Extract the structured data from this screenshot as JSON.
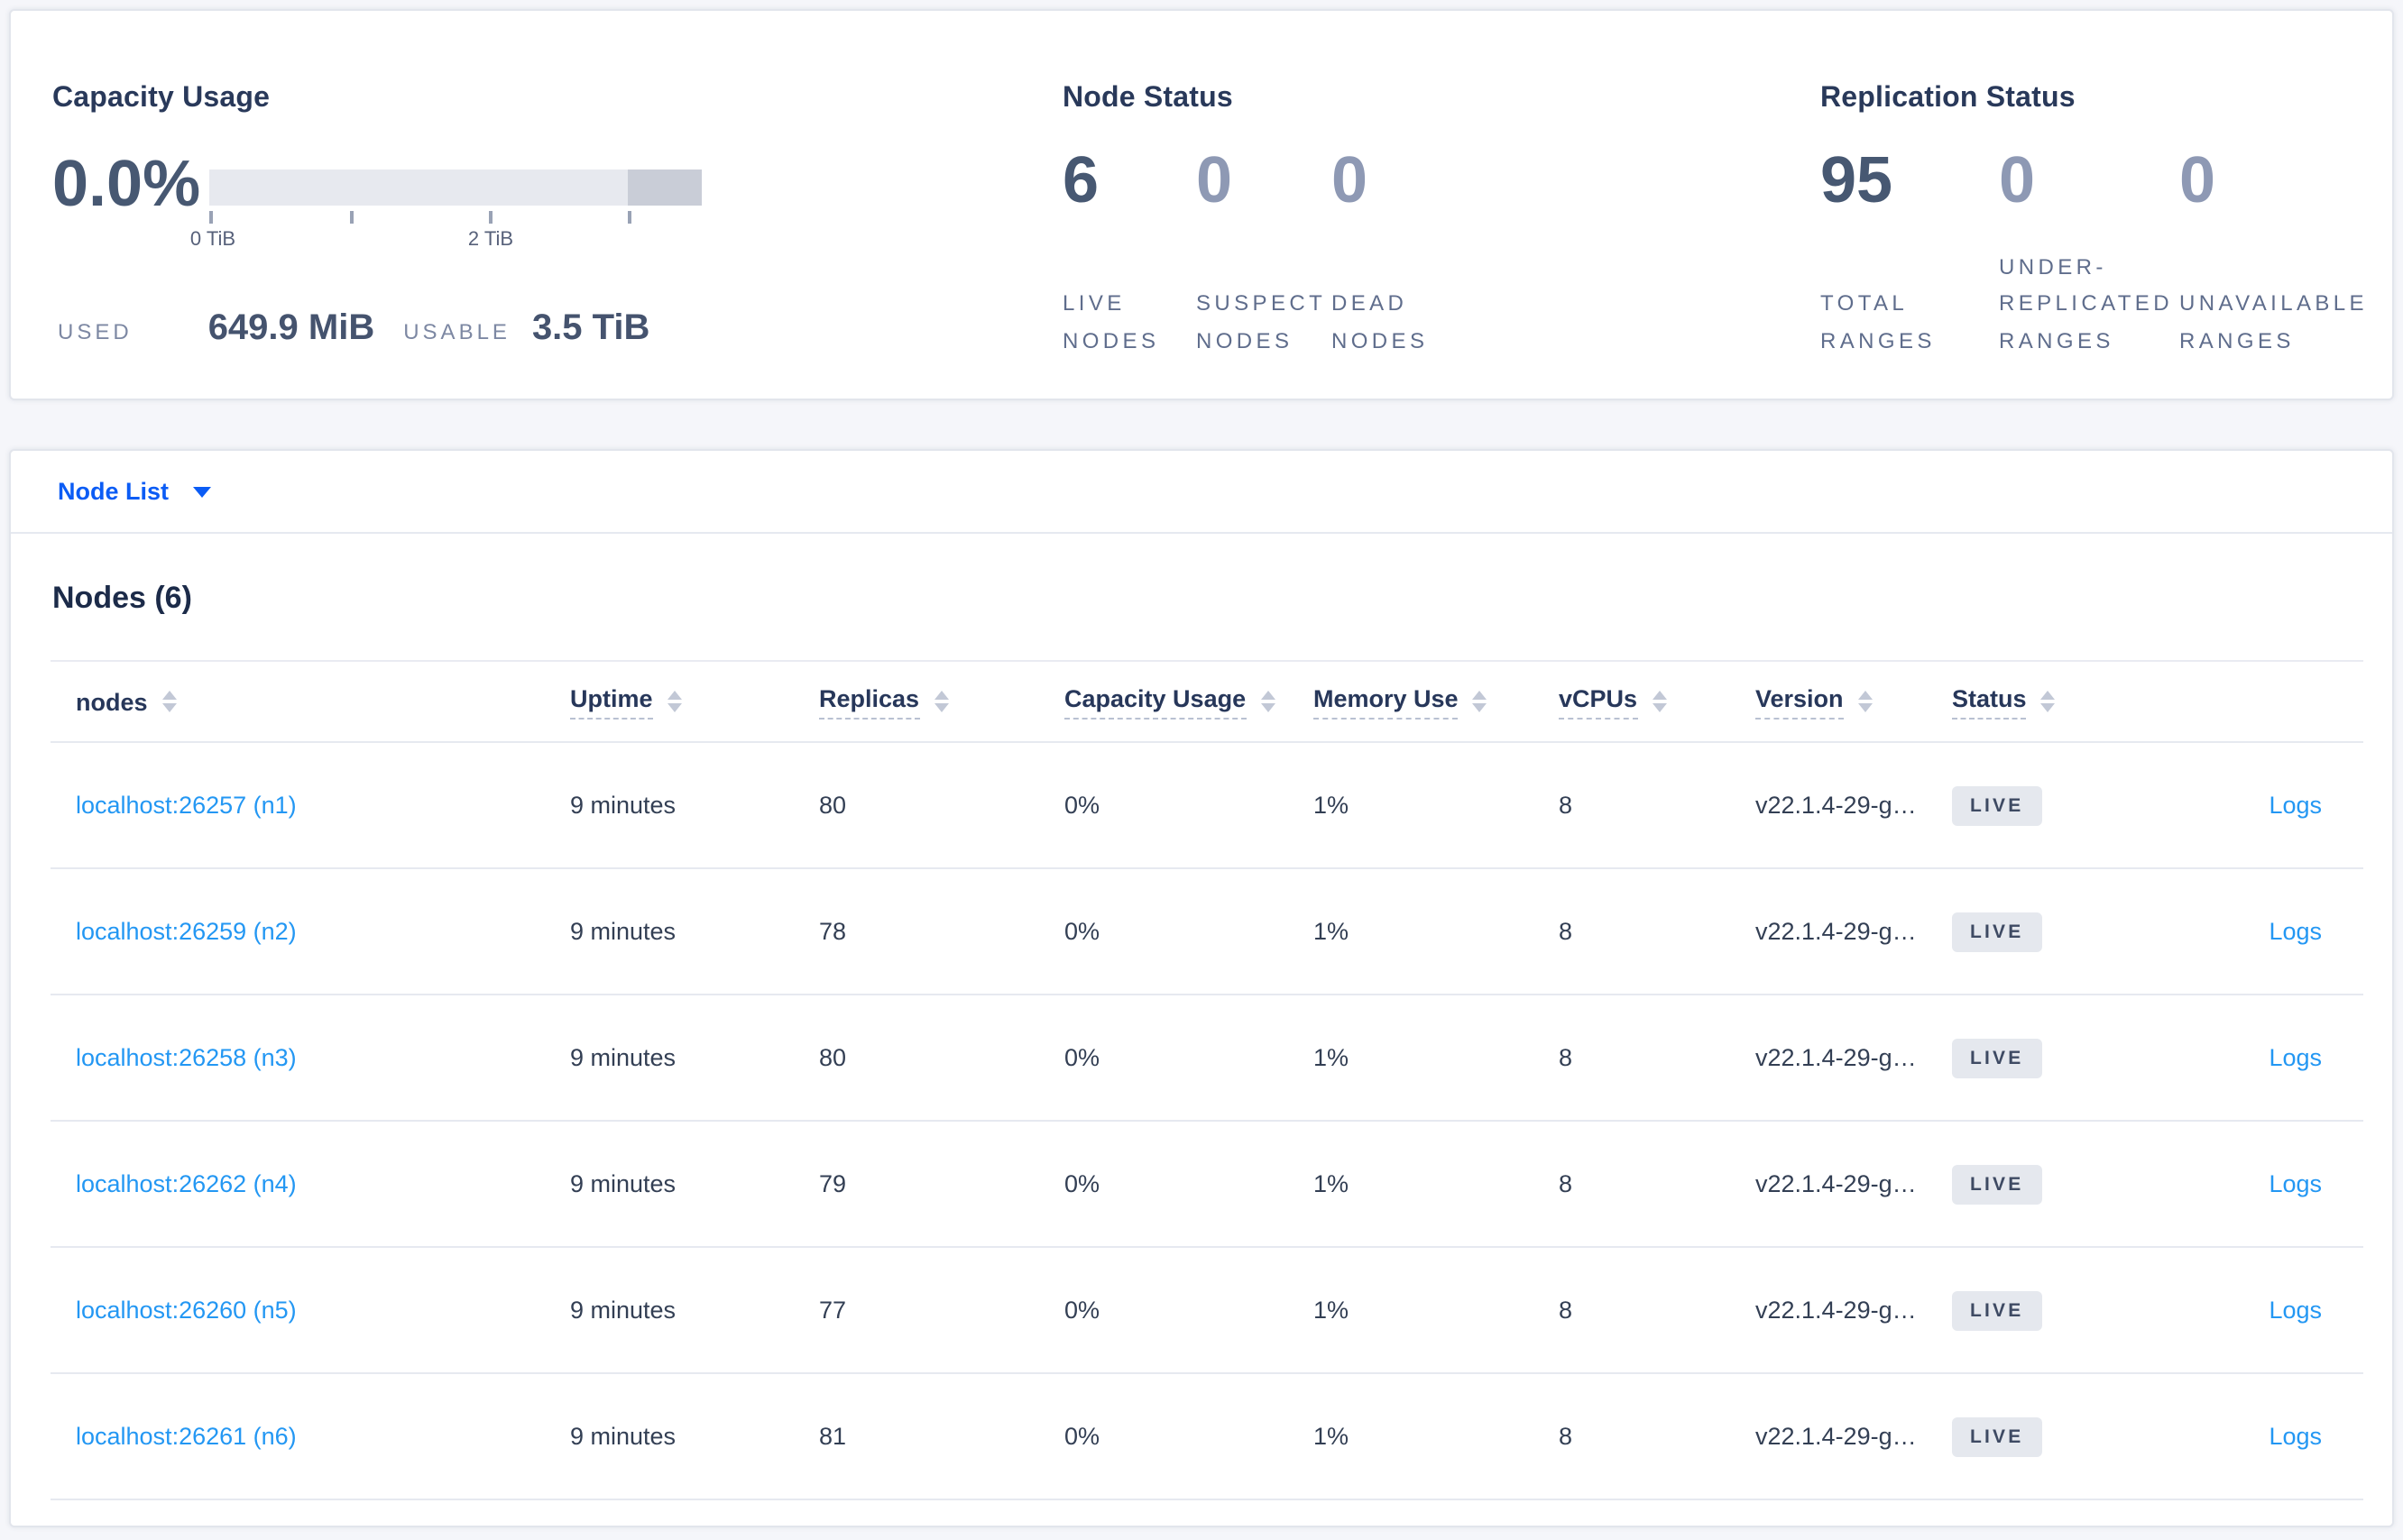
{
  "summary": {
    "capacity": {
      "title": "Capacity Usage",
      "percent": "0.0%",
      "tick_label_start": "0 TiB",
      "tick_label_mid": "2 TiB",
      "used_label": "USED",
      "used_value": "649.9 MiB",
      "usable_label": "USABLE",
      "usable_value": "3.5 TiB"
    },
    "node_status": {
      "title": "Node Status",
      "stats": [
        {
          "value": "6",
          "label": "LIVE NODES",
          "emphasized": true
        },
        {
          "value": "0",
          "label": "SUSPECT NODES",
          "emphasized": false
        },
        {
          "value": "0",
          "label": "DEAD NODES",
          "emphasized": false
        }
      ]
    },
    "replication_status": {
      "title": "Replication Status",
      "stats": [
        {
          "value": "95",
          "label": "TOTAL RANGES",
          "emphasized": true
        },
        {
          "value": "0",
          "label": "UNDER-REPLICATED RANGES",
          "emphasized": false
        },
        {
          "value": "0",
          "label": "UNAVAILABLE RANGES",
          "emphasized": false
        }
      ]
    }
  },
  "view_switcher": {
    "label": "Node List"
  },
  "nodes": {
    "heading": "Nodes (6)",
    "columns": [
      "nodes",
      "Uptime",
      "Replicas",
      "Capacity Usage",
      "Memory Use",
      "vCPUs",
      "Version",
      "Status"
    ],
    "rows": [
      {
        "node": "localhost:26257 (n1)",
        "uptime": "9 minutes",
        "replicas": "80",
        "capacity": "0%",
        "memory": "1%",
        "vcpus": "8",
        "version": "v22.1.4-29-g…",
        "status": "LIVE",
        "logs": "Logs"
      },
      {
        "node": "localhost:26259 (n2)",
        "uptime": "9 minutes",
        "replicas": "78",
        "capacity": "0%",
        "memory": "1%",
        "vcpus": "8",
        "version": "v22.1.4-29-g…",
        "status": "LIVE",
        "logs": "Logs"
      },
      {
        "node": "localhost:26258 (n3)",
        "uptime": "9 minutes",
        "replicas": "80",
        "capacity": "0%",
        "memory": "1%",
        "vcpus": "8",
        "version": "v22.1.4-29-g…",
        "status": "LIVE",
        "logs": "Logs"
      },
      {
        "node": "localhost:26262 (n4)",
        "uptime": "9 minutes",
        "replicas": "79",
        "capacity": "0%",
        "memory": "1%",
        "vcpus": "8",
        "version": "v22.1.4-29-g…",
        "status": "LIVE",
        "logs": "Logs"
      },
      {
        "node": "localhost:26260 (n5)",
        "uptime": "9 minutes",
        "replicas": "77",
        "capacity": "0%",
        "memory": "1%",
        "vcpus": "8",
        "version": "v22.1.4-29-g…",
        "status": "LIVE",
        "logs": "Logs"
      },
      {
        "node": "localhost:26261 (n6)",
        "uptime": "9 minutes",
        "replicas": "81",
        "capacity": "0%",
        "memory": "1%",
        "vcpus": "8",
        "version": "v22.1.4-29-g…",
        "status": "LIVE",
        "logs": "Logs"
      }
    ]
  },
  "colors": {
    "accent_blue": "#0b5cf5",
    "link_blue": "#2397f3",
    "dark_navy": "#29395a",
    "big_number": "#475872",
    "big_number_muted": "#8e99b4",
    "badge_bg": "#e5e8ee",
    "bar_track": "#e7e9ef",
    "bar_dark_segment": "#c9cdd7",
    "page_bg": "#f5f6fa"
  }
}
